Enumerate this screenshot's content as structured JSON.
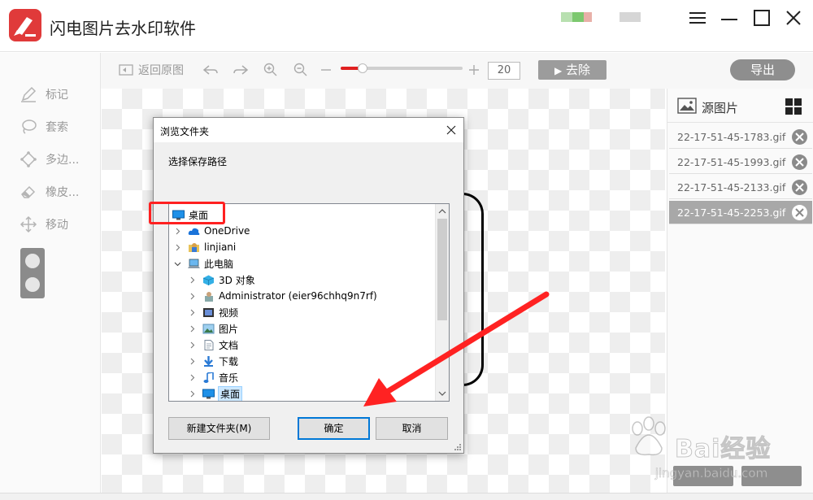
{
  "app": {
    "title": "闪电图片去水印软件"
  },
  "toolbar": {
    "restore_label": "返回原图",
    "zoom_value": "20",
    "zoom_fraction": 0.18,
    "remove_label": "去除",
    "export_label": "导出"
  },
  "tools": {
    "mark": "标记",
    "lasso": "套索",
    "polygon": "多边...",
    "eraser": "橡皮...",
    "move": "移动"
  },
  "right_panel": {
    "title": "源图片",
    "files": [
      {
        "name": "22-17-51-45-1783.gif",
        "selected": false
      },
      {
        "name": "22-17-51-45-1993.gif",
        "selected": false
      },
      {
        "name": "22-17-51-45-2133.gif",
        "selected": false
      },
      {
        "name": "22-17-51-45-2253.gif",
        "selected": true
      }
    ]
  },
  "dialog": {
    "title": "浏览文件夹",
    "prompt": "选择保存路径",
    "tree": [
      {
        "label": "桌面",
        "icon": "desktop-icon",
        "level": 0,
        "expander": "none",
        "selected": false
      },
      {
        "label": "OneDrive",
        "icon": "cloud-icon",
        "level": 1,
        "expander": "collapsed",
        "selected": false
      },
      {
        "label": "linjiani",
        "icon": "user-folder-icon",
        "level": 1,
        "expander": "collapsed",
        "selected": false
      },
      {
        "label": "此电脑",
        "icon": "computer-icon",
        "level": 1,
        "expander": "expanded",
        "selected": false
      },
      {
        "label": "3D 对象",
        "icon": "3d-objects-icon",
        "level": 2,
        "expander": "collapsed",
        "selected": false
      },
      {
        "label": "Administrator (eier96chhq9n7rf)",
        "icon": "user-icon",
        "level": 2,
        "expander": "collapsed",
        "selected": false
      },
      {
        "label": "视频",
        "icon": "video-icon",
        "level": 2,
        "expander": "collapsed",
        "selected": false
      },
      {
        "label": "图片",
        "icon": "pictures-icon",
        "level": 2,
        "expander": "collapsed",
        "selected": false
      },
      {
        "label": "文档",
        "icon": "documents-icon",
        "level": 2,
        "expander": "collapsed",
        "selected": false
      },
      {
        "label": "下载",
        "icon": "download-icon",
        "level": 2,
        "expander": "collapsed",
        "selected": false
      },
      {
        "label": "音乐",
        "icon": "music-icon",
        "level": 2,
        "expander": "collapsed",
        "selected": false
      },
      {
        "label": "桌面",
        "icon": "desktop-icon",
        "level": 2,
        "expander": "collapsed",
        "selected": true
      }
    ],
    "new_folder_label": "新建文件夹(M)",
    "ok_label": "确定",
    "cancel_label": "取消"
  },
  "watermark": {
    "text": "Bai经验",
    "sub": "jingyan.baidu.com"
  },
  "colors": {
    "brand_red": "#e03a3a",
    "annotation_red": "#ff2020",
    "selection_blue": "#cce8ff",
    "focus_blue": "#0078d7"
  }
}
